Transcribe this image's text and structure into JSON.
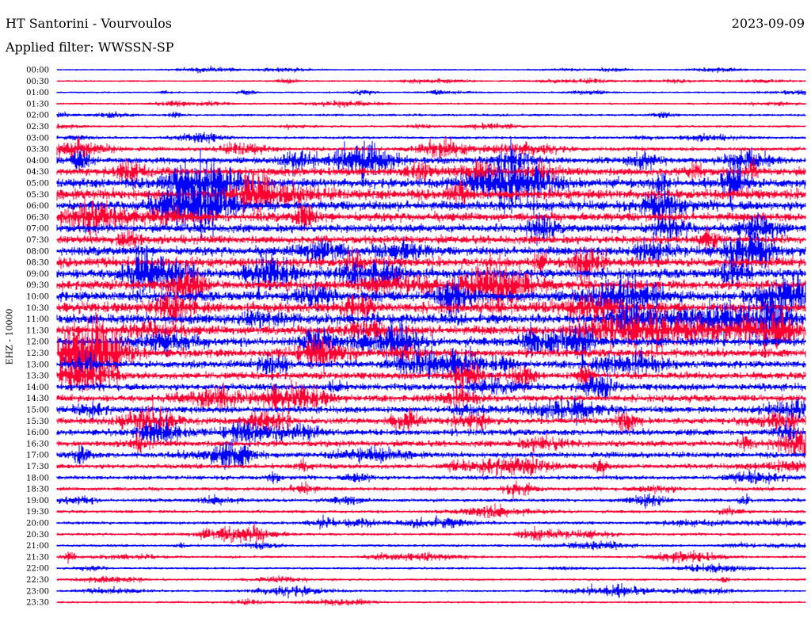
{
  "header": {
    "station": "HT Santorini - Vourvoulos",
    "date": "2023-09-09",
    "filter": "Applied filter: WWSSN-SP"
  },
  "channel_label": "EHZ - 10000",
  "colors": {
    "trace_a": "#0000ff",
    "trace_b": "#ff0033",
    "background": "#ffffff"
  },
  "chart_data": {
    "type": "helicorder",
    "ylabel": "EHZ - 10000",
    "row_labels": [
      "00:00",
      "00:30",
      "01:00",
      "01:30",
      "02:00",
      "02:30",
      "03:00",
      "03:30",
      "04:00",
      "04:30",
      "05:00",
      "05:30",
      "06:00",
      "06:30",
      "07:00",
      "07:30",
      "08:00",
      "08:30",
      "09:00",
      "09:30",
      "10:00",
      "10:30",
      "11:00",
      "11:30",
      "12:00",
      "12:30",
      "13:00",
      "13:30",
      "14:00",
      "14:30",
      "15:00",
      "15:30",
      "16:00",
      "16:30",
      "17:00",
      "17:30",
      "18:00",
      "18:30",
      "19:00",
      "19:30",
      "20:00",
      "20:30",
      "21:00",
      "21:30",
      "22:00",
      "22:30",
      "23:00",
      "23:30"
    ],
    "alternating_colors": [
      "#0000ff",
      "#ff0033"
    ],
    "relative_amplitude": [
      0.25,
      0.3,
      0.3,
      0.35,
      0.5,
      0.45,
      0.6,
      0.9,
      1.6,
      2.2,
      2.6,
      2.8,
      2.6,
      2.4,
      2.2,
      2.2,
      2.4,
      2.6,
      2.6,
      2.6,
      2.8,
      2.8,
      2.8,
      2.6,
      2.4,
      2.2,
      2.0,
      1.9,
      1.8,
      1.8,
      1.7,
      1.7,
      1.6,
      1.6,
      1.4,
      1.2,
      1.0,
      0.9,
      0.8,
      0.7,
      0.7,
      0.6,
      0.55,
      0.5,
      0.45,
      0.45,
      0.4,
      0.4
    ]
  }
}
